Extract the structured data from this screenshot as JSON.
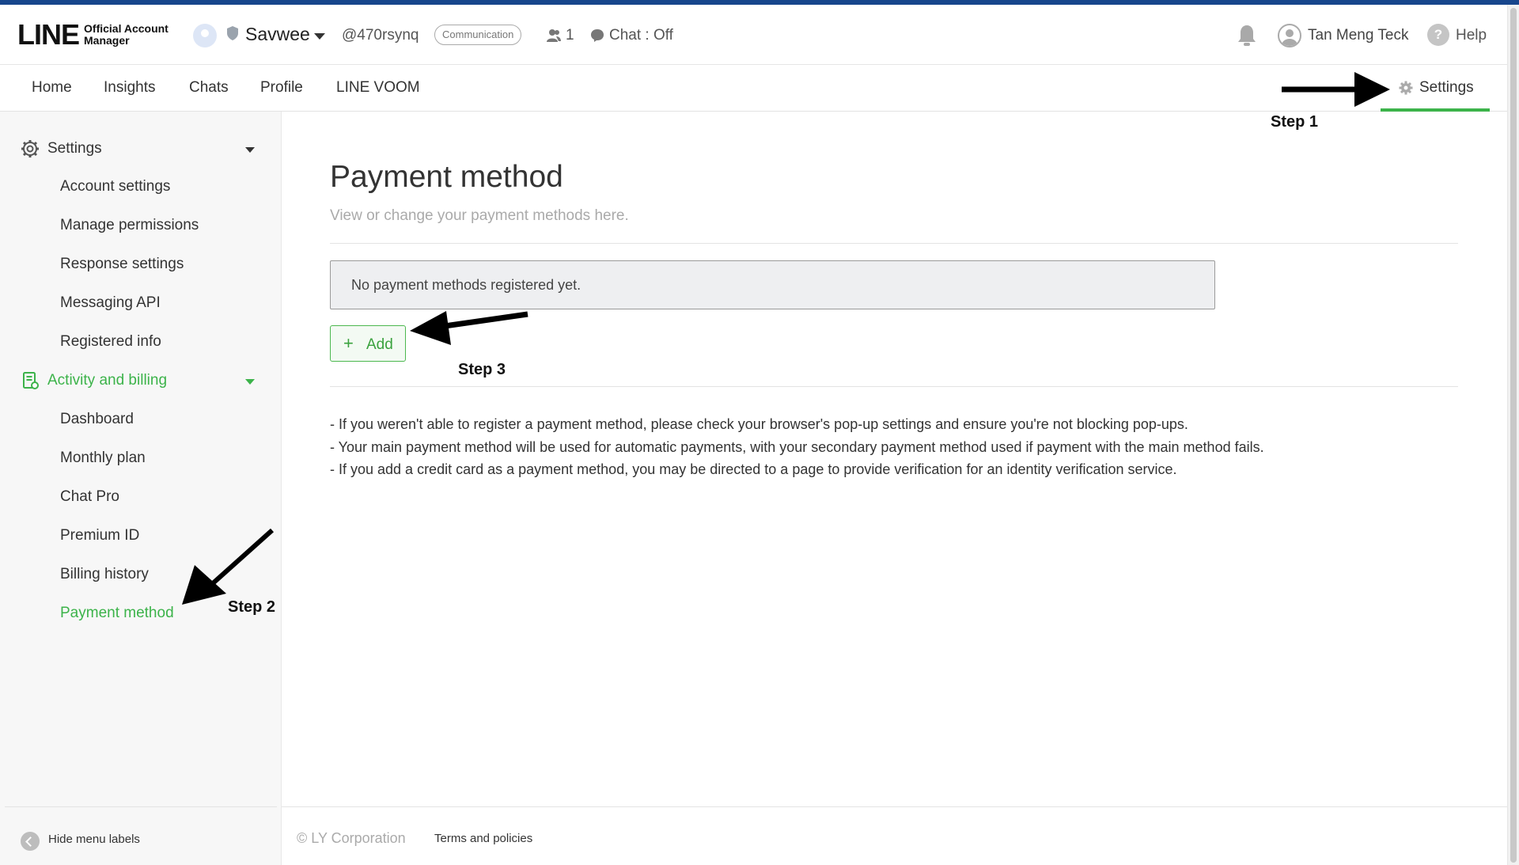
{
  "header": {
    "logo_main": "LINE",
    "logo_line1": "Official Account",
    "logo_line2": "Manager",
    "account_name": "Savwee",
    "account_id": "@470rsynq",
    "plan_badge": "Communication",
    "friends_count": "1",
    "chat_status": "Chat : Off",
    "user_name": "Tan Meng Teck",
    "help_glyph": "?",
    "help_label": "Help"
  },
  "nav": {
    "tabs": [
      "Home",
      "Insights",
      "Chats",
      "Profile",
      "LINE VOOM"
    ],
    "settings_label": "Settings"
  },
  "sidebar": {
    "settings_section": "Settings",
    "settings_items": [
      "Account settings",
      "Manage permissions",
      "Response settings",
      "Messaging API",
      "Registered info"
    ],
    "billing_section": "Activity and billing",
    "billing_items": [
      "Dashboard",
      "Monthly plan",
      "Chat Pro",
      "Premium ID",
      "Billing history",
      "Payment method"
    ],
    "active_item": "Payment method",
    "collapse_label": "Hide menu labels"
  },
  "main": {
    "title": "Payment method",
    "subtitle": "View or change your payment methods here.",
    "empty_message": "No payment methods registered yet.",
    "add_glyph": "+",
    "add_label": "Add",
    "notes": [
      "- If you weren't able to register a payment method, please check your browser's pop-up settings and ensure you're not blocking pop-ups.",
      "- Your main payment method will be used for automatic payments, with your secondary payment method used if payment with the main method fails.",
      "- If you add a credit card as a payment method, you may be directed to a page to provide verification for an identity verification service."
    ]
  },
  "footer": {
    "copyright": "© LY Corporation",
    "terms": "Terms and policies"
  },
  "annotations": {
    "step1": "Step 1",
    "step2": "Step 2",
    "step3": "Step 3"
  },
  "colors": {
    "accent_green": "#3cb34a",
    "top_stripe": "#17468c",
    "active_text": "#3cb34a"
  },
  "icons": [
    "shield-icon",
    "friends-icon",
    "chat-bubble-icon",
    "bell-icon",
    "user-avatar",
    "help-icon",
    "gear-icon",
    "billing-doc-icon",
    "chevron-left-icon",
    "plus-icon"
  ]
}
